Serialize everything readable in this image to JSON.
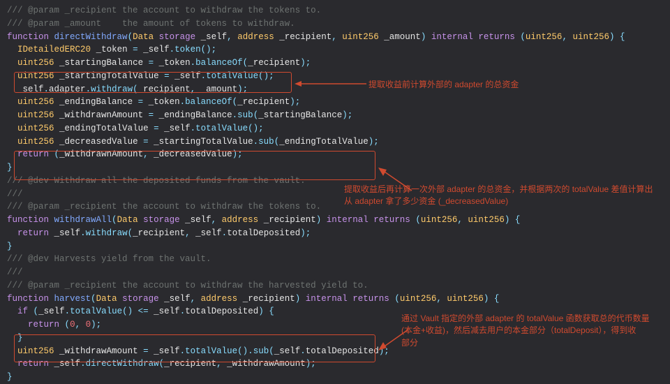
{
  "c1": "/// @param _recipient the account to withdraw the tokens to.",
  "c2": "/// @param _amount    the amount of tokens to withdraw.",
  "l3": "function directWithdraw(Data storage _self, address _recipient, uint256 _amount) internal returns (uint256, uint256) {",
  "l4": "  IDetailedERC20 _token = _self.token();",
  "blank": "",
  "l6": "  uint256 _startingBalance = _token.balanceOf(_recipient);",
  "l7": "  uint256 _startingTotalValue = _self.totalValue();",
  "l9": "  _self.adapter.withdraw(_recipient, _amount);",
  "l11": "  uint256 _endingBalance = _token.balanceOf(_recipient);",
  "l12": "  uint256 _withdrawnAmount = _endingBalance.sub(_startingBalance);",
  "l14": "  uint256 _endingTotalValue = _self.totalValue();",
  "l15": "  uint256 _decreasedValue = _startingTotalValue.sub(_endingTotalValue);",
  "l17": "  return (_withdrawnAmount, _decreasedValue);",
  "l18": "}",
  "c19": "/// @dev Withdraw all the deposited funds from the vault.",
  "c20": "///",
  "c21": "/// @param _recipient the account to withdraw the tokens to.",
  "l22": "function withdrawAll(Data storage _self, address _recipient) internal returns (uint256, uint256) {",
  "l23": "  return _self.withdraw(_recipient, _self.totalDeposited);",
  "l24": "}",
  "c25": "/// @dev Harvests yield from the vault.",
  "c26": "///",
  "c27": "/// @param _recipient the account to withdraw the harvested yield to.",
  "l28": "function harvest(Data storage _self, address _recipient) internal returns (uint256, uint256) {",
  "l29": "  if (_self.totalValue() <= _self.totalDeposited) {",
  "l30": "    return (0, 0);",
  "l31": "  }",
  "l32": "  uint256 _withdrawAmount = _self.totalValue().sub(_self.totalDeposited);",
  "l33": "  return _self.directWithdraw(_recipient, _withdrawAmount);",
  "l34": "}",
  "ann1": "提取收益前计算外部的 adapter 的总资金",
  "ann2a": "提取收益后再计算一次外部 adapter 的总资金，并根据两次的 totalValue 差值计算出",
  "ann2b": "从 adapter 拿了多少资金 (_decreasedValue)",
  "ann3a": "通过 Vault 指定的外部 adapter 的 totalValue 函数获取总的代币数量",
  "ann3b": "(本金+收益)，然后减去用户的本金部分（totalDeposit），得到收",
  "ann3c": "部分"
}
